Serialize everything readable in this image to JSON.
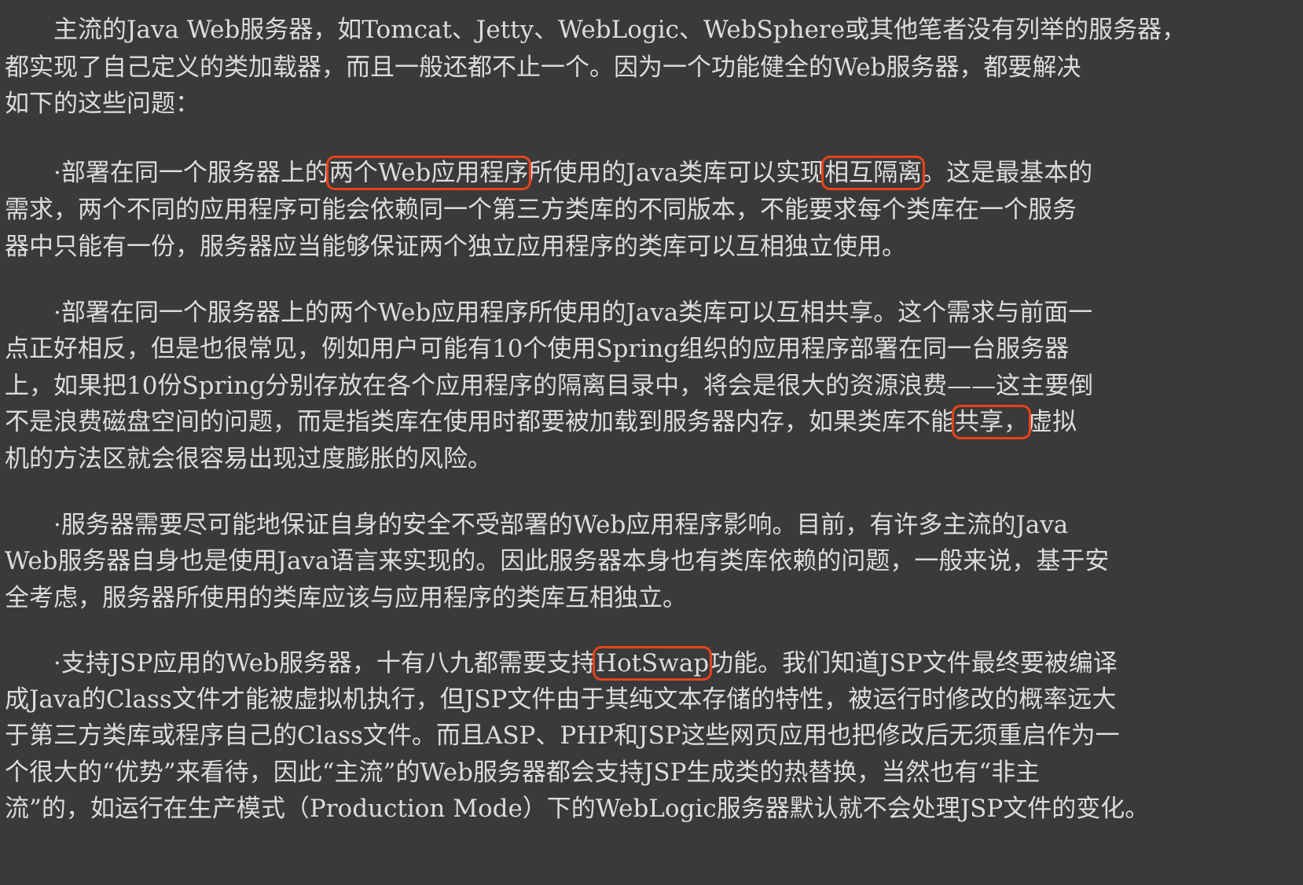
{
  "paragraphs": {
    "p1": {
      "l1": "　　主流的Java Web服务器，如Tomcat、Jetty、WebLogic、WebSphere或其他笔者没有列举的服务器，",
      "l2": "都实现了自己定义的类加载器，而且一般还都不止一个。因为一个功能健全的Web服务器，都要解决",
      "l3": "如下的这些问题："
    },
    "p2": {
      "l1_a": "　　·部署在同一个服务器上的",
      "l1_hl1": "两个Web应用程序",
      "l1_b": "所使用的Java类库可以实现",
      "l1_hl2": "相互隔离",
      "l1_c": "。这是最基本的",
      "l2": "需求，两个不同的应用程序可能会依赖同一个第三方类库的不同版本，不能要求每个类库在一个服务",
      "l3": "器中只能有一份，服务器应当能够保证两个独立应用程序的类库可以互相独立使用。"
    },
    "p3": {
      "l1": "　　·部署在同一个服务器上的两个Web应用程序所使用的Java类库可以互相共享。这个需求与前面一",
      "l2": "点正好相反，但是也很常见，例如用户可能有10个使用Spring组织的应用程序部署在同一台服务器",
      "l3": "上，如果把10份Spring分别存放在各个应用程序的隔离目录中，将会是很大的资源浪费——这主要倒",
      "l4_a": "不是浪费磁盘空间的问题，而是指类库在使用时都要被加载到服务器内存，如果类库不能",
      "l4_hl": "共享，",
      "l4_b": "虚拟",
      "l5": "机的方法区就会很容易出现过度膨胀的风险。"
    },
    "p4": {
      "l1": "　　·服务器需要尽可能地保证自身的安全不受部署的Web应用程序影响。目前，有许多主流的Java",
      "l2": "Web服务器自身也是使用Java语言来实现的。因此服务器本身也有类库依赖的问题，一般来说，基于安",
      "l3": "全考虑，服务器所使用的类库应该与应用程序的类库互相独立。"
    },
    "p5": {
      "l1_a": "　　·支持JSP应用的Web服务器，十有八九都需要支持",
      "l1_hl": "HotSwap",
      "l1_b": "功能。我们知道JSP文件最终要被编译",
      "l2": "成Java的Class文件才能被虚拟机执行，但JSP文件由于其纯文本存储的特性，被运行时修改的概率远大",
      "l3": "于第三方类库或程序自己的Class文件。而且ASP、PHP和JSP这些网页应用也把修改后无须重启作为一",
      "l4": "个很大的“优势”来看待，因此“主流”的Web服务器都会支持JSP生成类的热替换，当然也有“非主",
      "l5": "流”的，如运行在生产模式（Production Mode）下的WebLogic服务器默认就不会处理JSP文件的变化。"
    }
  },
  "colors": {
    "background": "#3a3a3a",
    "text": "#dcdcdc",
    "highlight_box": "#e8431b"
  }
}
